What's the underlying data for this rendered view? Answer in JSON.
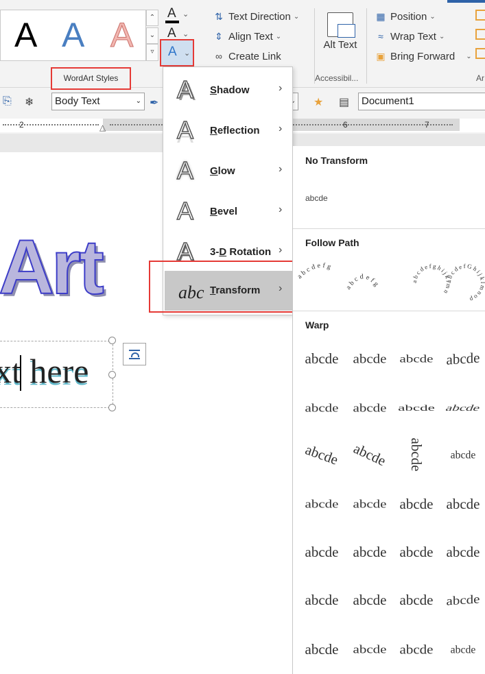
{
  "ribbon": {
    "wordart_styles_label": "WordArt Styles",
    "wordart_letter": "A",
    "text_direction": "Text Direction",
    "align_text": "Align Text",
    "create_link": "Create Link",
    "alt_text": "Alt Text",
    "accessibility_group": "Accessibil...",
    "position": "Position",
    "wrap_text": "Wrap Text",
    "bring_forward": "Bring Forward",
    "arrange_group": "Ar"
  },
  "toolbar2": {
    "style_value": "Body Text",
    "document_name": "Document1"
  },
  "ruler": {
    "marks": [
      "2",
      "6",
      "7"
    ]
  },
  "document": {
    "wordart_heading": "Art",
    "wordart_text": "xt here"
  },
  "effects_menu": {
    "items": [
      {
        "label": "Shadow",
        "accel": "S",
        "rest": "hadow"
      },
      {
        "label": "Reflection",
        "accel": "R",
        "rest": "eflection"
      },
      {
        "label": "Glow",
        "accel": "G",
        "rest": "low"
      },
      {
        "label": "Bevel",
        "accel": "B",
        "rest": "evel"
      },
      {
        "label": "3-D Rotation",
        "pre": "3-",
        "accel": "D",
        "rest": " Rotation"
      },
      {
        "label": "Transform",
        "accel": "T",
        "rest": "ransform"
      }
    ],
    "icon_letter": "A",
    "transform_icon": "abc"
  },
  "transform_gallery": {
    "no_transform_header": "No Transform",
    "no_transform_sample": "abcde",
    "follow_path_header": "Follow Path",
    "warp_header": "Warp",
    "warp_sample": "abcde",
    "follow_path_samples": [
      "abcdefg",
      "abcdefg",
      "abcdefghijklmn",
      "abcdefGhijklmnop"
    ]
  },
  "colors": {
    "accent_blue": "#2e62a8",
    "highlight_red": "#e53935",
    "wordart_outline": "#3d3dc8"
  }
}
